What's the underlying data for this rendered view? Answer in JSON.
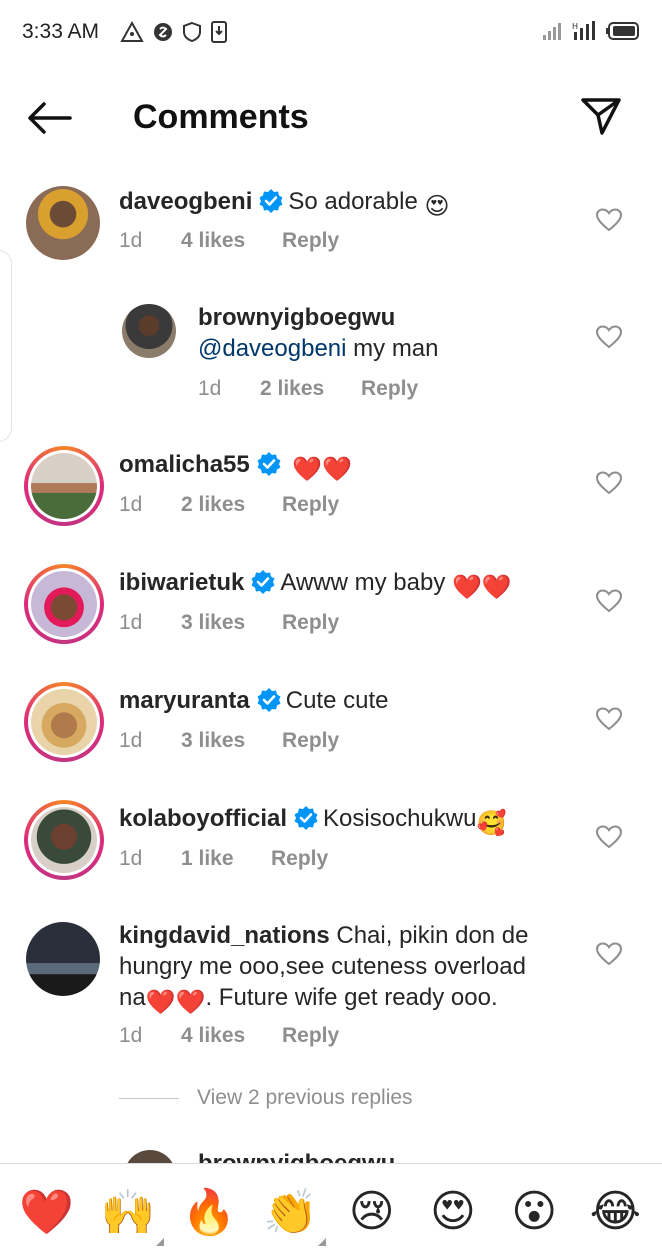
{
  "status_bar": {
    "time": "3:33 AM"
  },
  "header": {
    "title": "Comments"
  },
  "comments": [
    {
      "username": "daveogbeni",
      "verified": true,
      "text": "So adorable",
      "emoji": "😍",
      "time": "1d",
      "likes": "4 likes",
      "reply": "Reply"
    },
    {
      "username": "brownyigboegwu",
      "verified": false,
      "mention": "@daveogbeni",
      "text": "my man",
      "time": "1d",
      "likes": "2 likes",
      "reply": "Reply"
    },
    {
      "username": "omalicha55",
      "verified": true,
      "text": "",
      "emoji": "❤️❤️",
      "time": "1d",
      "likes": "2 likes",
      "reply": "Reply"
    },
    {
      "username": "ibiwarietuk",
      "verified": true,
      "text": "Awww my baby",
      "emoji": "❤️❤️",
      "time": "1d",
      "likes": "3 likes",
      "reply": "Reply"
    },
    {
      "username": "maryuranta",
      "verified": true,
      "text": "Cute cute",
      "time": "1d",
      "likes": "3 likes",
      "reply": "Reply"
    },
    {
      "username": "kolaboyofficial",
      "verified": true,
      "text": "Kosisochukwu",
      "emoji": "🥰",
      "time": "1d",
      "likes": "1 like",
      "reply": "Reply"
    },
    {
      "username": "kingdavid_nations",
      "verified": false,
      "text_a": "Chai, pikin don de hungry me ooo,see cuteness overload na",
      "emoji": "❤️❤️",
      "text_b": ". Future wife get ready ooo.",
      "time": "1d",
      "likes": "4 likes",
      "reply": "Reply"
    }
  ],
  "view_previous": "View 2 previous replies",
  "partial_username": "brownyigboegwu",
  "emoji_bar": [
    "❤️",
    "🙌",
    "🔥",
    "👏",
    "😢",
    "😍",
    "😮",
    "😂"
  ],
  "colors": {
    "verified": "#0095f6",
    "meta_gray": "#8e8e8e",
    "mention": "#00376b",
    "heart_red": "#e0141e"
  }
}
